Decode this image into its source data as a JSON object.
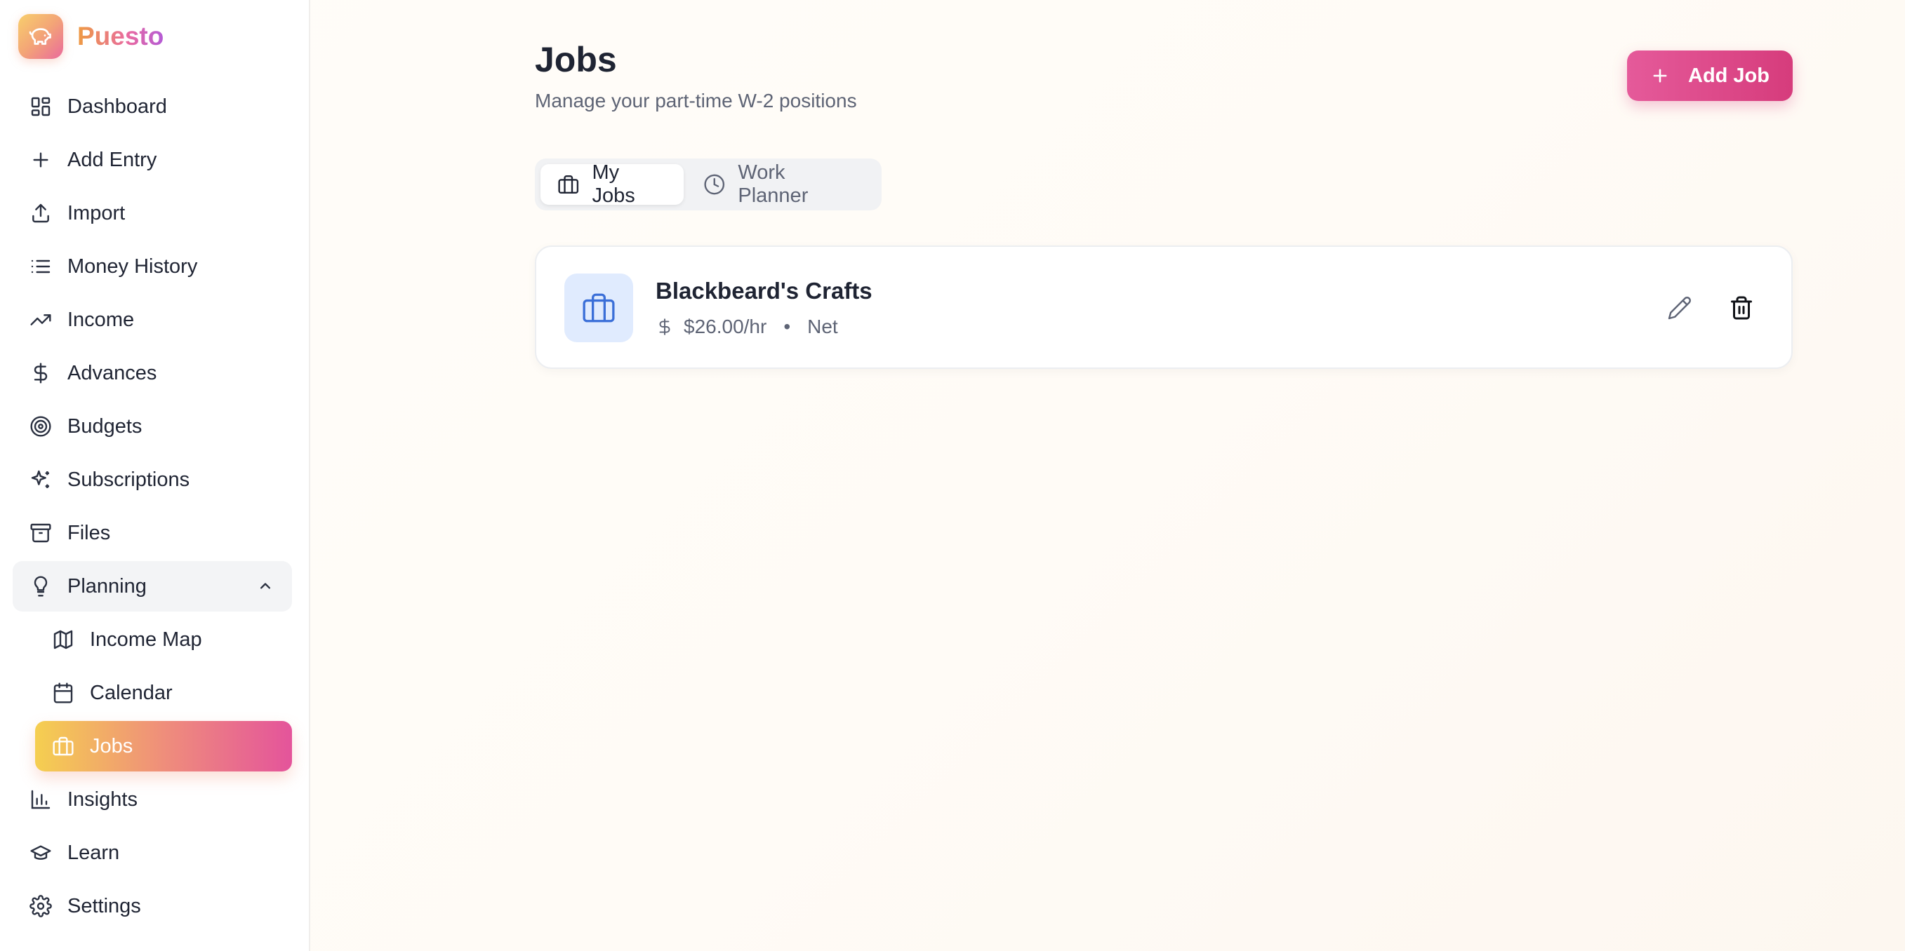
{
  "brand": {
    "name": "Puesto",
    "logo_icon": "piggy-bank-icon"
  },
  "sidebar": {
    "items": [
      {
        "label": "Dashboard",
        "icon": "dashboard-grid-icon"
      },
      {
        "label": "Add Entry",
        "icon": "plus-icon"
      },
      {
        "label": "Import",
        "icon": "upload-icon"
      },
      {
        "label": "Money History",
        "icon": "list-icon"
      },
      {
        "label": "Income",
        "icon": "trending-up-icon"
      },
      {
        "label": "Advances",
        "icon": "dollar-icon"
      },
      {
        "label": "Budgets",
        "icon": "target-icon"
      },
      {
        "label": "Subscriptions",
        "icon": "sparkles-icon"
      },
      {
        "label": "Files",
        "icon": "archive-icon"
      },
      {
        "label": "Planning",
        "icon": "lightbulb-icon",
        "expanded": true
      },
      {
        "label": "Income Map",
        "icon": "map-icon"
      },
      {
        "label": "Calendar",
        "icon": "calendar-icon"
      },
      {
        "label": "Jobs",
        "icon": "briefcase-icon",
        "active": true
      },
      {
        "label": "Insights",
        "icon": "bar-chart-icon"
      },
      {
        "label": "Learn",
        "icon": "graduation-cap-icon"
      },
      {
        "label": "Settings",
        "icon": "gear-icon"
      }
    ]
  },
  "header": {
    "title": "Jobs",
    "subtitle": "Manage your part-time W-2 positions",
    "add_button_label": "Add Job"
  },
  "tabs": [
    {
      "label": "My Jobs",
      "active": true
    },
    {
      "label": "Work Planner",
      "active": false
    }
  ],
  "jobs": [
    {
      "name": "Blackbeard's Crafts",
      "rate": "$26.00/hr",
      "separator": "•",
      "pay_type": "Net"
    }
  ],
  "colors": {
    "accent_pink": "#e55a9a",
    "active_gradient_start": "#f5cf50",
    "active_gradient_end": "#e4549b",
    "job_icon_bg": "#e0ebfe",
    "job_icon": "#3b6fd8"
  }
}
